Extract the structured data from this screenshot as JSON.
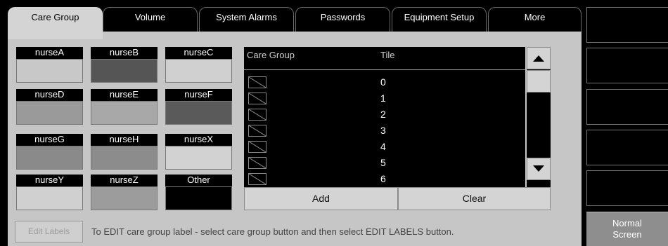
{
  "tabs": [
    {
      "label": "Care Group",
      "active": true
    },
    {
      "label": "Volume",
      "active": false
    },
    {
      "label": "System Alarms",
      "active": false
    },
    {
      "label": "Passwords",
      "active": false
    },
    {
      "label": "Equipment Setup",
      "active": false
    },
    {
      "label": "More",
      "active": false
    }
  ],
  "care_groups": [
    {
      "label": "nurseA",
      "color": "#c8c8c8"
    },
    {
      "label": "nurseB",
      "color": "#555555"
    },
    {
      "label": "nurseC",
      "color": "#d0d0d0"
    },
    {
      "label": "nurseD",
      "color": "#9a9a9a"
    },
    {
      "label": "nurseE",
      "color": "#a8a8a8"
    },
    {
      "label": "nurseF",
      "color": "#5a5a5a"
    },
    {
      "label": "nurseG",
      "color": "#8a8a8a"
    },
    {
      "label": "nurseH",
      "color": "#8c8c8c"
    },
    {
      "label": "nurseX",
      "color": "#d2d2d2"
    },
    {
      "label": "nurseY",
      "color": "#d0d0d0"
    },
    {
      "label": "nurseZ",
      "color": "#9c9c9c"
    },
    {
      "label": "Other",
      "color": "#000000"
    }
  ],
  "list": {
    "header_care_group": "Care Group",
    "header_tile": "Tile",
    "rows": [
      "0",
      "1",
      "2",
      "3",
      "4",
      "5",
      "6"
    ]
  },
  "actions": {
    "add": "Add",
    "clear": "Clear"
  },
  "bottom": {
    "edit_labels": "Edit Labels",
    "hint": "To EDIT care group label - select care group button and then select EDIT LABELS button."
  },
  "sidebar": {
    "normal_screen_line1": "Normal",
    "normal_screen_line2": "Screen"
  }
}
